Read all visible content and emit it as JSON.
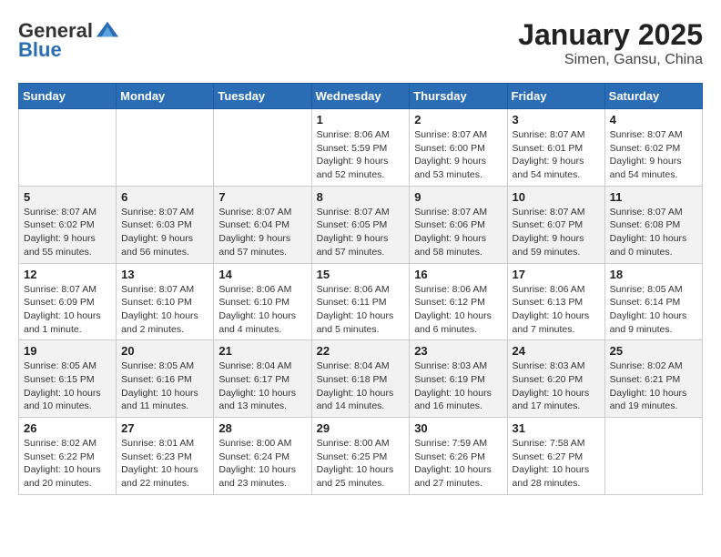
{
  "header": {
    "logo": {
      "general": "General",
      "blue": "Blue"
    },
    "title": "January 2025",
    "location": "Simen, Gansu, China"
  },
  "calendar": {
    "days_of_week": [
      "Sunday",
      "Monday",
      "Tuesday",
      "Wednesday",
      "Thursday",
      "Friday",
      "Saturday"
    ],
    "weeks": [
      [
        {
          "day": "",
          "info": ""
        },
        {
          "day": "",
          "info": ""
        },
        {
          "day": "",
          "info": ""
        },
        {
          "day": "1",
          "info": "Sunrise: 8:06 AM\nSunset: 5:59 PM\nDaylight: 9 hours and 52 minutes."
        },
        {
          "day": "2",
          "info": "Sunrise: 8:07 AM\nSunset: 6:00 PM\nDaylight: 9 hours and 53 minutes."
        },
        {
          "day": "3",
          "info": "Sunrise: 8:07 AM\nSunset: 6:01 PM\nDaylight: 9 hours and 54 minutes."
        },
        {
          "day": "4",
          "info": "Sunrise: 8:07 AM\nSunset: 6:02 PM\nDaylight: 9 hours and 54 minutes."
        }
      ],
      [
        {
          "day": "5",
          "info": "Sunrise: 8:07 AM\nSunset: 6:02 PM\nDaylight: 9 hours and 55 minutes."
        },
        {
          "day": "6",
          "info": "Sunrise: 8:07 AM\nSunset: 6:03 PM\nDaylight: 9 hours and 56 minutes."
        },
        {
          "day": "7",
          "info": "Sunrise: 8:07 AM\nSunset: 6:04 PM\nDaylight: 9 hours and 57 minutes."
        },
        {
          "day": "8",
          "info": "Sunrise: 8:07 AM\nSunset: 6:05 PM\nDaylight: 9 hours and 57 minutes."
        },
        {
          "day": "9",
          "info": "Sunrise: 8:07 AM\nSunset: 6:06 PM\nDaylight: 9 hours and 58 minutes."
        },
        {
          "day": "10",
          "info": "Sunrise: 8:07 AM\nSunset: 6:07 PM\nDaylight: 9 hours and 59 minutes."
        },
        {
          "day": "11",
          "info": "Sunrise: 8:07 AM\nSunset: 6:08 PM\nDaylight: 10 hours and 0 minutes."
        }
      ],
      [
        {
          "day": "12",
          "info": "Sunrise: 8:07 AM\nSunset: 6:09 PM\nDaylight: 10 hours and 1 minute."
        },
        {
          "day": "13",
          "info": "Sunrise: 8:07 AM\nSunset: 6:10 PM\nDaylight: 10 hours and 2 minutes."
        },
        {
          "day": "14",
          "info": "Sunrise: 8:06 AM\nSunset: 6:10 PM\nDaylight: 10 hours and 4 minutes."
        },
        {
          "day": "15",
          "info": "Sunrise: 8:06 AM\nSunset: 6:11 PM\nDaylight: 10 hours and 5 minutes."
        },
        {
          "day": "16",
          "info": "Sunrise: 8:06 AM\nSunset: 6:12 PM\nDaylight: 10 hours and 6 minutes."
        },
        {
          "day": "17",
          "info": "Sunrise: 8:06 AM\nSunset: 6:13 PM\nDaylight: 10 hours and 7 minutes."
        },
        {
          "day": "18",
          "info": "Sunrise: 8:05 AM\nSunset: 6:14 PM\nDaylight: 10 hours and 9 minutes."
        }
      ],
      [
        {
          "day": "19",
          "info": "Sunrise: 8:05 AM\nSunset: 6:15 PM\nDaylight: 10 hours and 10 minutes."
        },
        {
          "day": "20",
          "info": "Sunrise: 8:05 AM\nSunset: 6:16 PM\nDaylight: 10 hours and 11 minutes."
        },
        {
          "day": "21",
          "info": "Sunrise: 8:04 AM\nSunset: 6:17 PM\nDaylight: 10 hours and 13 minutes."
        },
        {
          "day": "22",
          "info": "Sunrise: 8:04 AM\nSunset: 6:18 PM\nDaylight: 10 hours and 14 minutes."
        },
        {
          "day": "23",
          "info": "Sunrise: 8:03 AM\nSunset: 6:19 PM\nDaylight: 10 hours and 16 minutes."
        },
        {
          "day": "24",
          "info": "Sunrise: 8:03 AM\nSunset: 6:20 PM\nDaylight: 10 hours and 17 minutes."
        },
        {
          "day": "25",
          "info": "Sunrise: 8:02 AM\nSunset: 6:21 PM\nDaylight: 10 hours and 19 minutes."
        }
      ],
      [
        {
          "day": "26",
          "info": "Sunrise: 8:02 AM\nSunset: 6:22 PM\nDaylight: 10 hours and 20 minutes."
        },
        {
          "day": "27",
          "info": "Sunrise: 8:01 AM\nSunset: 6:23 PM\nDaylight: 10 hours and 22 minutes."
        },
        {
          "day": "28",
          "info": "Sunrise: 8:00 AM\nSunset: 6:24 PM\nDaylight: 10 hours and 23 minutes."
        },
        {
          "day": "29",
          "info": "Sunrise: 8:00 AM\nSunset: 6:25 PM\nDaylight: 10 hours and 25 minutes."
        },
        {
          "day": "30",
          "info": "Sunrise: 7:59 AM\nSunset: 6:26 PM\nDaylight: 10 hours and 27 minutes."
        },
        {
          "day": "31",
          "info": "Sunrise: 7:58 AM\nSunset: 6:27 PM\nDaylight: 10 hours and 28 minutes."
        },
        {
          "day": "",
          "info": ""
        }
      ]
    ]
  }
}
